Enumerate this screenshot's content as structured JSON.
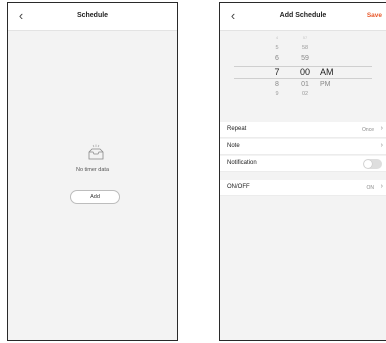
{
  "schedule_screen": {
    "back_icon": "chevron-left-icon",
    "title": "Schedule",
    "empty_icon": "empty-inbox-icon",
    "empty_text": "No timer data",
    "add_label": "Add"
  },
  "add_schedule_screen": {
    "back_icon": "chevron-left-icon",
    "title": "Add Schedule",
    "save_label": "Save",
    "accent_color": "#e8582a",
    "picker": {
      "hour": {
        "above": [
          "5",
          "6"
        ],
        "selected": "7",
        "below": [
          "8",
          "9"
        ]
      },
      "minute": {
        "above": [
          "58",
          "59"
        ],
        "selected": "00",
        "below": [
          "01",
          "02"
        ]
      },
      "ampm": {
        "selected": "AM",
        "below": [
          "PM"
        ]
      }
    },
    "rows": {
      "repeat": {
        "label": "Repeat",
        "value": "Once"
      },
      "note": {
        "label": "Note"
      },
      "notification": {
        "label": "Notification",
        "toggle_on": false
      },
      "onoff": {
        "label": "ON/OFF",
        "value": "ON"
      }
    }
  }
}
